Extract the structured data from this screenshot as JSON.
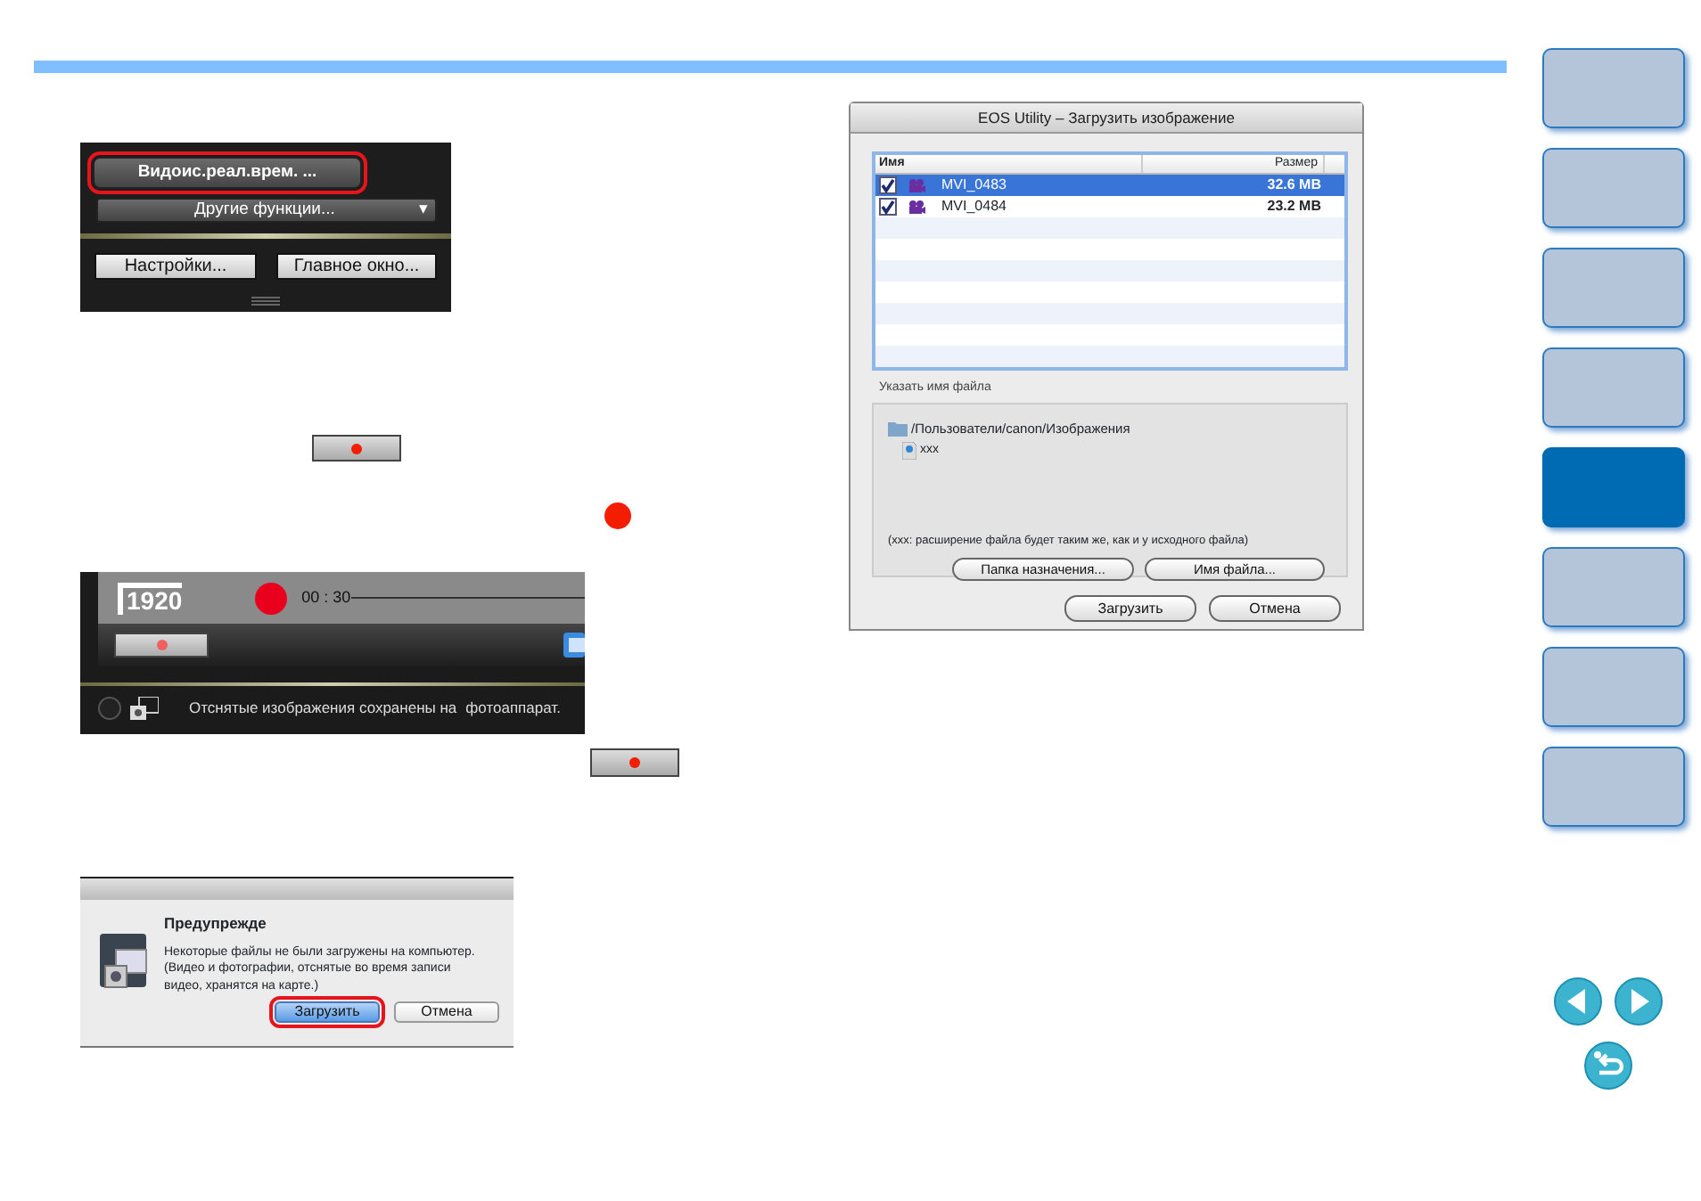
{
  "nav_tabs": [
    {
      "selected": false
    },
    {
      "selected": false
    },
    {
      "selected": false
    },
    {
      "selected": false
    },
    {
      "selected": true
    },
    {
      "selected": false
    },
    {
      "selected": false
    },
    {
      "selected": false
    }
  ],
  "step_panel": {
    "realtime_button": {
      "label": "Видоис.реал.врем. ...",
      "highlighted": true
    },
    "other_functions_menu": "Другие функции...",
    "menu_caret": "▾",
    "settings_button": "Настройки...",
    "main_window_button": "Главное окно..."
  },
  "recording_panel": {
    "resolution_badge": "1920",
    "timer": "00 : 30",
    "status_text": "Отснятые изображения сохранены на",
    "status_text_2": "фотоаппарат."
  },
  "warning_dialog": {
    "title": "Предупрежде",
    "message": "Некоторые файлы не были загружены на компьютер. (Видео и фотографии, отснятые во время записи видео, хранятся на карте.)",
    "buttons": [
      {
        "label": "Загрузить",
        "highlighted": true,
        "default": true
      },
      {
        "label": "Отмена",
        "highlighted": false,
        "default": false
      }
    ]
  },
  "download_dialog": {
    "title": "EOS Utility – Загрузить изображение",
    "columns": [
      "Имя",
      "Размер"
    ],
    "rows": [
      {
        "name": "MVI_0483",
        "size": "32.6 MB",
        "checked": true,
        "selected": true
      },
      {
        "name": "MVI_0484",
        "size": "23.2 MB",
        "checked": true,
        "selected": false
      }
    ],
    "section_label": "Указать имя файла",
    "folder_path": "/Пользователи/canon/Изображения",
    "file_name": "xxx",
    "note": "(xxx: расширение файла будет таким же, как и у исходного файла)",
    "group_buttons": [
      "Папка назначения...",
      "Имя файла..."
    ],
    "footer_buttons": [
      "Загрузить",
      "Отмена"
    ]
  }
}
